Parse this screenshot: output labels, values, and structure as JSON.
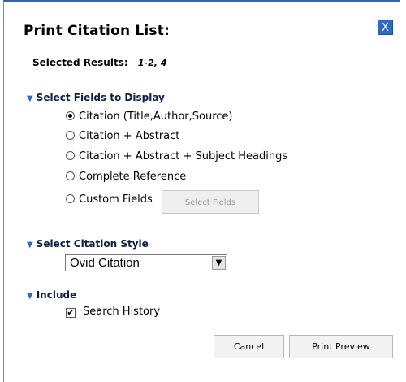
{
  "dialog": {
    "title": "Print Citation List:",
    "close_label": "X",
    "selected_label": "Selected Results:",
    "selected_value": "1-2, 4"
  },
  "fields_section": {
    "heading": "Select Fields to Display",
    "options": [
      {
        "label": "Citation (Title,Author,Source)",
        "checked": true
      },
      {
        "label": "Citation + Abstract",
        "checked": false
      },
      {
        "label": "Citation + Abstract + Subject Headings",
        "checked": false
      },
      {
        "label": "Complete Reference",
        "checked": false
      },
      {
        "label": "Custom Fields",
        "checked": false
      }
    ],
    "select_fields_button": "Select Fields"
  },
  "style_section": {
    "heading": "Select Citation Style",
    "selected": "Ovid Citation"
  },
  "include_section": {
    "heading": "Include",
    "search_history_label": "Search History",
    "search_history_checked": true
  },
  "buttons": {
    "cancel": "Cancel",
    "print_preview": "Print Preview"
  }
}
